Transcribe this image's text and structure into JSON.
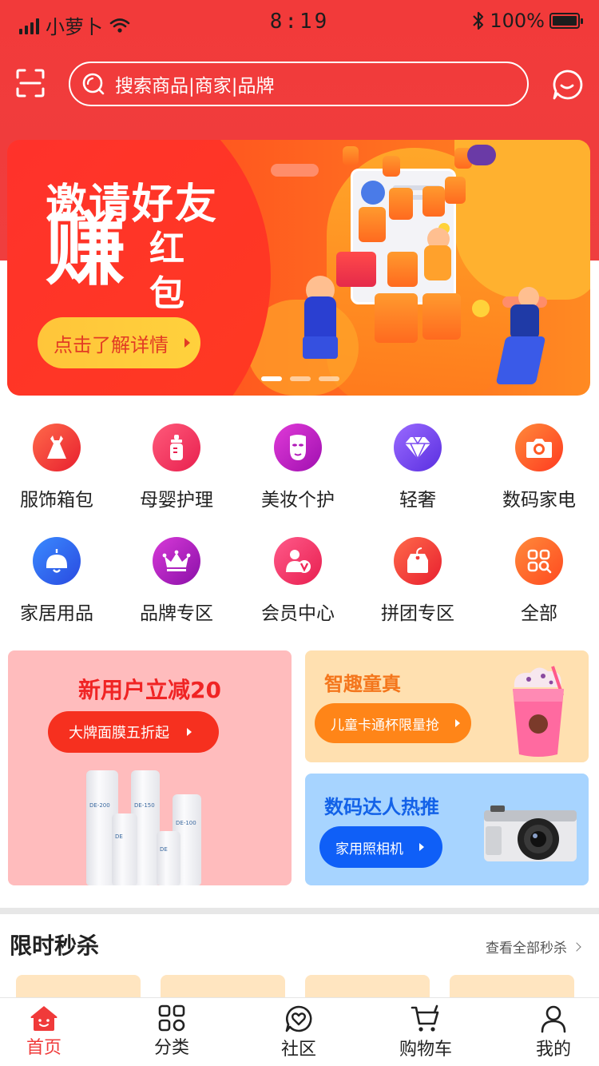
{
  "status_bar": {
    "carrier": "小萝卜",
    "time": "8:19",
    "battery": "100%"
  },
  "search": {
    "placeholder": "搜索商品|商家|品牌"
  },
  "banner": {
    "title": "邀请好友",
    "big_char": "赚",
    "small_char1": "红",
    "small_char2": "包",
    "button": "点击了解详情",
    "active_dot": 0,
    "dot_count": 3
  },
  "categories": [
    {
      "label": "服饰箱包",
      "icon": "dress-icon",
      "color": "#f23a3a"
    },
    {
      "label": "母婴护理",
      "icon": "baby-bottle-icon",
      "color": "#f2336a"
    },
    {
      "label": "美妆个护",
      "icon": "face-mask-icon",
      "color": "#c218b8"
    },
    {
      "label": "轻奢",
      "icon": "diamond-icon",
      "color": "#7b4df0"
    },
    {
      "label": "数码家电",
      "icon": "camera-icon",
      "color": "#ff5a24"
    },
    {
      "label": "家居用品",
      "icon": "lamp-icon",
      "color": "#2f6ff0"
    },
    {
      "label": "品牌专区",
      "icon": "crown-icon",
      "color": "#b51ac2"
    },
    {
      "label": "会员中心",
      "icon": "vip-member-icon",
      "color": "#f0285a"
    },
    {
      "label": "拼团专区",
      "icon": "tag-icon",
      "color": "#f03a3a"
    },
    {
      "label": "全部",
      "icon": "grid-search-icon",
      "color": "#ff6a24"
    }
  ],
  "promos": {
    "left": {
      "title": "新用户立减20",
      "button": "大牌面膜五折起",
      "bottle_labels": [
        "DE-200",
        "DE-150",
        "DE-100",
        "DE",
        "DE"
      ]
    },
    "right_top": {
      "title": "智趣童真",
      "button": "儿童卡通杯限量抢"
    },
    "right_bottom": {
      "title": "数码达人热推",
      "button": "家用照相机"
    }
  },
  "flash_sale": {
    "title": "限时秒杀",
    "more": "查看全部秒杀"
  },
  "tabbar": [
    {
      "label": "首页",
      "icon": "home-icon",
      "active": true
    },
    {
      "label": "分类",
      "icon": "category-grid-icon",
      "active": false
    },
    {
      "label": "社区",
      "icon": "community-heart-icon",
      "active": false
    },
    {
      "label": "购物车",
      "icon": "cart-icon",
      "active": false
    },
    {
      "label": "我的",
      "icon": "user-icon",
      "active": false
    }
  ],
  "colors": {
    "brand_red": "#f03a3a",
    "active_tab": "#f03a3a"
  }
}
